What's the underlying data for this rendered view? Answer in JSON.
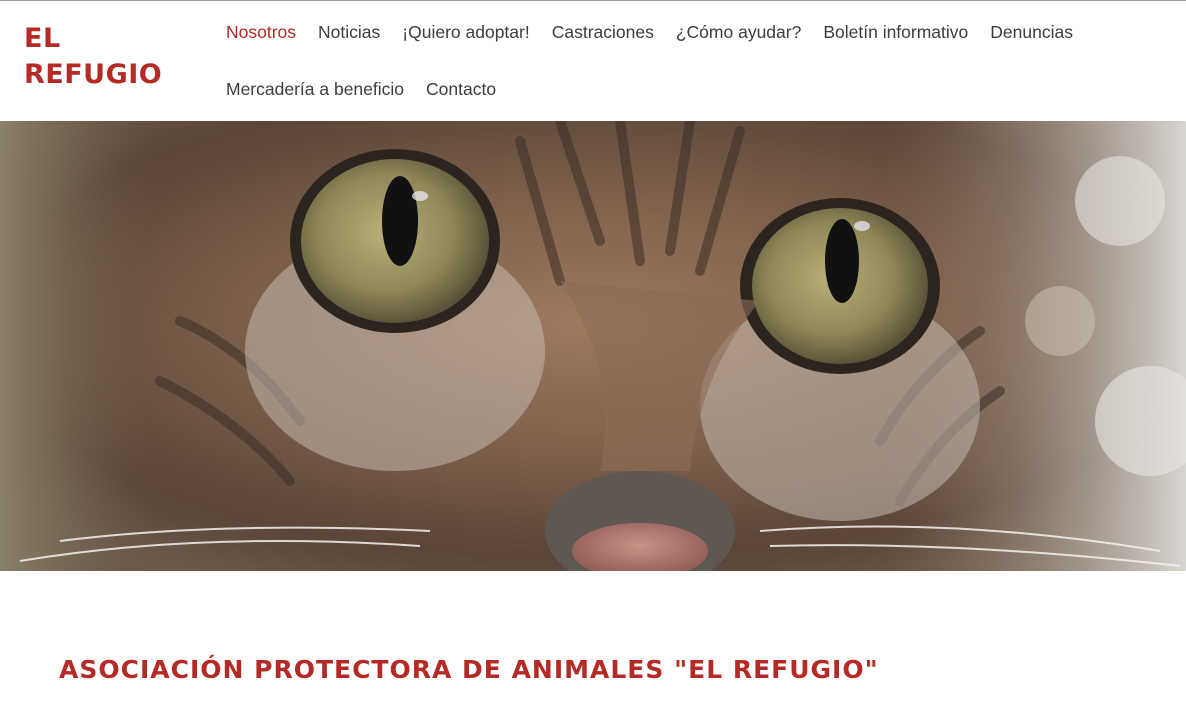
{
  "logo": {
    "line1": "EL",
    "line2": "REFUGIO"
  },
  "nav": {
    "row1": [
      {
        "label": "Nosotros",
        "active": true
      },
      {
        "label": "Noticias"
      },
      {
        "label": "¡Quiero adoptar!"
      },
      {
        "label": "Castraciones"
      },
      {
        "label": "¿Cómo ayudar?"
      },
      {
        "label": "Boletín informativo"
      },
      {
        "label": "Denuncias"
      }
    ],
    "row2": [
      {
        "label": "Mercadería a beneficio"
      },
      {
        "label": "Contacto"
      }
    ]
  },
  "main": {
    "title": "ASOCIACIÓN PROTECTORA DE ANIMALES \"EL REFUGIO\""
  },
  "colors": {
    "brand": "#b52a25",
    "nav_text": "#3d3d3d"
  }
}
